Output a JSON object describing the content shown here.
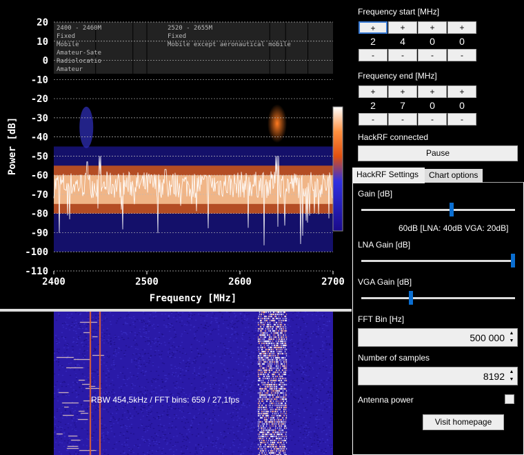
{
  "chart_data": {
    "type": "line",
    "xlabel": "Frequency [MHz]",
    "ylabel": "Power [dB]",
    "xlim": [
      2400,
      2700
    ],
    "ylim": [
      -110,
      20
    ],
    "xticks": [
      2400,
      2500,
      2600,
      2700
    ],
    "yticks": [
      20,
      10,
      0,
      -10,
      -20,
      -30,
      -40,
      -50,
      -60,
      -70,
      -80,
      -90,
      -100,
      -110
    ],
    "noise_floor_db": -65,
    "peaks": [
      {
        "freq": 2435,
        "db": -53
      },
      {
        "freq": 2450,
        "db": -50
      },
      {
        "freq": 2520,
        "db": -57
      },
      {
        "freq": 2640,
        "db": -50
      }
    ],
    "bands": [
      {
        "range": "2400 - 2460M",
        "services": [
          "Fixed",
          "Mobile",
          "Amateur-Sate",
          "Radiolocatio",
          "Amateur"
        ]
      },
      {
        "range": "2520 - 2655M",
        "services": [
          "Fixed",
          "Mobile except aeronautical mobile"
        ]
      }
    ]
  },
  "waterfall": {
    "status": "RBW 454,5kHz / FFT bins: 659 / 27,1fps"
  },
  "freq_start": {
    "label": "Frequency start [MHz]",
    "digits": [
      "2",
      "4",
      "0",
      "0"
    ],
    "plus": "+",
    "minus": "-"
  },
  "freq_end": {
    "label": "Frequency end [MHz]",
    "digits": [
      "2",
      "7",
      "0",
      "0"
    ],
    "plus": "+",
    "minus": "-"
  },
  "status": "HackRF connected",
  "pause_label": "Pause",
  "tabs": [
    "HackRF Settings",
    "Chart options"
  ],
  "settings": {
    "gain_label": "Gain [dB]",
    "gain_value": 60,
    "gain_text": "60dB  [LNA: 40dB  VGA: 20dB]",
    "lna_label": "LNA Gain [dB]",
    "lna_value": 40,
    "vga_label": "VGA Gain [dB]",
    "vga_value": 20,
    "fft_label": "FFT Bin [Hz]",
    "fft_value": "500 000",
    "samples_label": "Number of samples",
    "samples_value": "8192",
    "antenna_label": "Antenna power",
    "homepage_label": "Visit homepage"
  }
}
